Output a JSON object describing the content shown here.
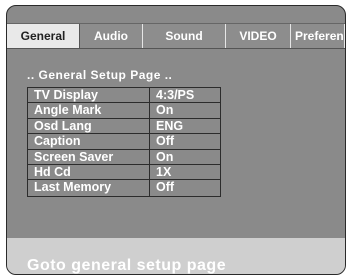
{
  "tabs": [
    {
      "label": "General",
      "active": true
    },
    {
      "label": "Audio",
      "active": false
    },
    {
      "label": "Sound",
      "active": false
    },
    {
      "label": "VIDEO",
      "active": false
    },
    {
      "label": "Preferen",
      "active": false
    }
  ],
  "page_title": ".. General Setup Page ..",
  "settings": [
    {
      "label": "TV Display",
      "value": "4:3/PS"
    },
    {
      "label": "Angle Mark",
      "value": "On"
    },
    {
      "label": "Osd Lang",
      "value": "ENG"
    },
    {
      "label": "Caption",
      "value": "Off"
    },
    {
      "label": "Screen Saver",
      "value": "On"
    },
    {
      "label": "Hd Cd",
      "value": "1X"
    },
    {
      "label": "Last Memory",
      "value": "Off"
    }
  ],
  "status_text": "Goto general setup page",
  "colors": {
    "panel_bg": "#8a8a8a",
    "tab_active_bg": "#e9e9e9",
    "tab_inactive_bg": "#8d8d8d",
    "status_bar_bg": "#cfcfcf",
    "text": "#ffffff"
  }
}
